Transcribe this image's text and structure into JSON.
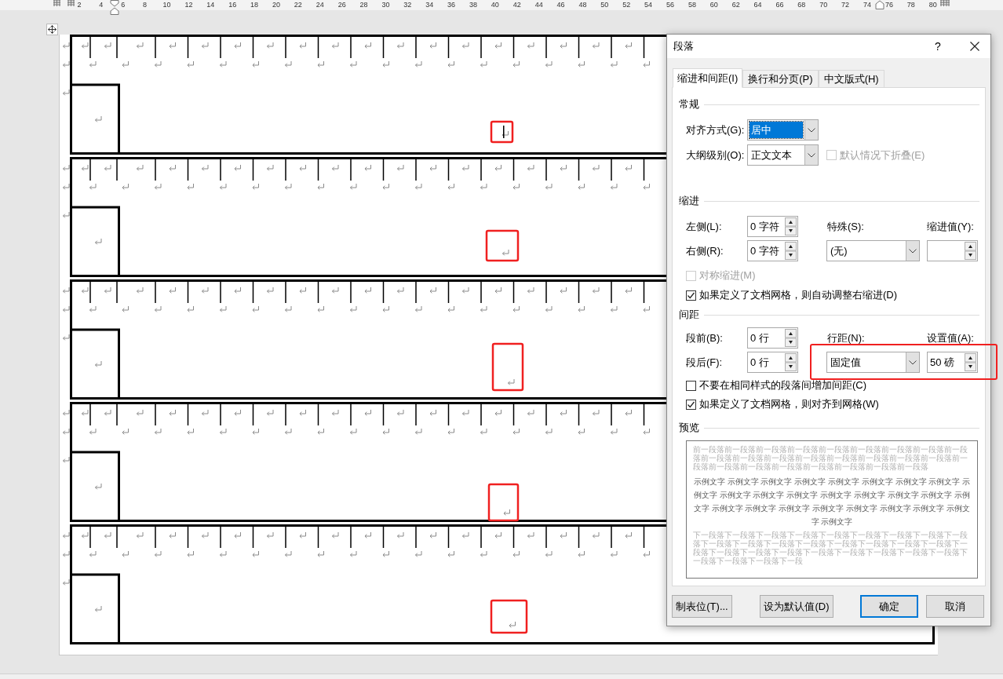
{
  "ruler": {
    "labels": [
      "2",
      "4",
      "6",
      "8",
      "10",
      "12",
      "14",
      "16",
      "18",
      "20",
      "22",
      "24",
      "26",
      "28",
      "30",
      "32",
      "34",
      "36",
      "38",
      "40",
      "42",
      "44",
      "46",
      "48",
      "50",
      "52",
      "54",
      "56",
      "58",
      "60",
      "62",
      "64",
      "66",
      "68",
      "70",
      "72",
      "74",
      "76",
      "78",
      "80"
    ]
  },
  "document": {
    "tables": [
      {
        "cursor": true
      },
      {
        "cursor": false
      },
      {
        "cursor": false
      },
      {
        "cursor": false
      },
      {
        "cursor": false
      }
    ]
  },
  "dialog": {
    "title": "段落",
    "help": "?",
    "tabs": [
      {
        "label": "缩进和间距(I)",
        "selected": true
      },
      {
        "label": "换行和分页(P)",
        "selected": false
      },
      {
        "label": "中文版式(H)",
        "selected": false
      }
    ],
    "general": {
      "heading": "常规",
      "alignment": {
        "label": "对齐方式(G):",
        "value": "居中",
        "highlighted": true
      },
      "outline_level": {
        "label": "大纲级别(O):",
        "value": "正文文本",
        "highlighted": false
      },
      "collapse": {
        "label": "默认情况下折叠(E)",
        "checked": false,
        "disabled": true
      }
    },
    "indent": {
      "heading": "缩进",
      "left": {
        "label": "左侧(L):",
        "value": "0 字符"
      },
      "right": {
        "label": "右侧(R):",
        "value": "0 字符"
      },
      "special": {
        "label": "特殊(S):",
        "value": "(无)"
      },
      "by": {
        "label": "缩进值(Y):"
      },
      "mirror": {
        "label": "对称缩进(M)",
        "checked": false,
        "disabled": true
      },
      "auto_adjust": {
        "label": "如果定义了文档网格，则自动调整右缩进(D)",
        "checked": true,
        "disabled": false
      }
    },
    "spacing": {
      "heading": "间距",
      "before": {
        "label": "段前(B):",
        "value": "0 行"
      },
      "after": {
        "label": "段后(F):",
        "value": "0 行"
      },
      "line_spacing": {
        "label": "行距(N):",
        "value": "固定值"
      },
      "at": {
        "label": "设置值(A):",
        "value": "50 磅"
      },
      "dont_add": {
        "label": "不要在相同样式的段落间增加间距(C)",
        "checked": false,
        "disabled": false
      },
      "snap": {
        "label": "如果定义了文档网格，则对齐到网格(W)",
        "checked": true,
        "disabled": false
      }
    },
    "preview": {
      "heading": "预览",
      "preceding": "前一段落前一段落前一段落前一段落前一段落前一段落前一段落前一段落前一段落前一段落前一段落前一段落前一段落前一段落前一段落前一段落前一段落前一段落前一段落前一段落前一段落前一段落前一段落前一段落前一段落",
      "sample": "示例文字 示例文字 示例文字 示例文字 示例文字 示例文字 示例文字 示例文字 示例文字 示例文字 示例文字 示例文字 示例文字 示例文字 示例文字 示例文字 示例文字 示例文字 示例文字 示例文字 示例文字 示例文字 示例文字 示例文字 示例文字 示例文字",
      "following": "下一段落下一段落下一段落下一段落下一段落下一段落下一段落下一段落下一段落下一段落下一段落下一段落下一段落下一段落下一段落下一段落下一段落下一段落下一段落下一段落下一段落下一段落下一段落下一段落下一段落下一段落下一段落下一段落下一段落下一段"
    },
    "buttons": [
      {
        "label": "制表位(T)...",
        "default": false
      },
      {
        "label": "设为默认值(D)",
        "default": false
      },
      {
        "label": "确定",
        "default": true
      },
      {
        "label": "取消",
        "default": false
      }
    ]
  }
}
